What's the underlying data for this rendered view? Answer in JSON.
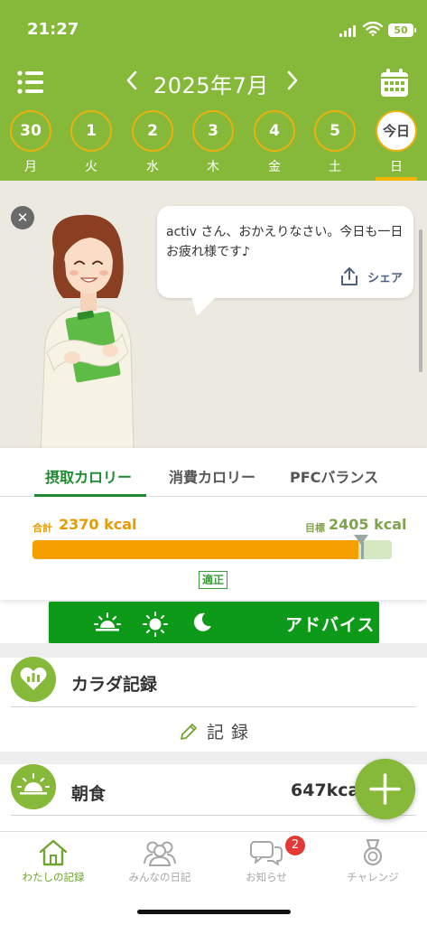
{
  "status": {
    "time": "21:27",
    "battery": "50"
  },
  "header": {
    "month_label": "2025年7月",
    "prev": "<",
    "next": ">",
    "days": [
      {
        "num": "30",
        "wd": "月"
      },
      {
        "num": "1",
        "wd": "火"
      },
      {
        "num": "2",
        "wd": "水"
      },
      {
        "num": "3",
        "wd": "木"
      },
      {
        "num": "4",
        "wd": "金"
      },
      {
        "num": "5",
        "wd": "土"
      },
      {
        "num": "今日",
        "wd": "日"
      }
    ]
  },
  "hero": {
    "close": "✕",
    "message": "activ さん、おかえりなさい。今日も一日お疲れ様です♪",
    "share": "シェア"
  },
  "calorie": {
    "tabs": [
      "摂取カロリー",
      "消費カロリー",
      "PFCバランス"
    ],
    "total_label": "合計",
    "total_value": "2370 kcal",
    "target_label": "目標",
    "target_value": "2405 kcal",
    "intake": 2370,
    "target": 2405,
    "status": "適正"
  },
  "advice": {
    "label": "アドバイス"
  },
  "body_record": {
    "title": "カラダ記録",
    "button": "記録"
  },
  "meal": {
    "title": "朝食",
    "kcal": "647kcal"
  },
  "tabbar": {
    "items": [
      "わたしの記録",
      "みんなの日記",
      "お知らせ",
      "チャレンジ"
    ],
    "badge": "2"
  },
  "colors": {
    "brand_green": "#86b93a",
    "advice_green": "#0d9a18",
    "orange": "#f5a000",
    "tab_active": "#1e8a2f"
  }
}
